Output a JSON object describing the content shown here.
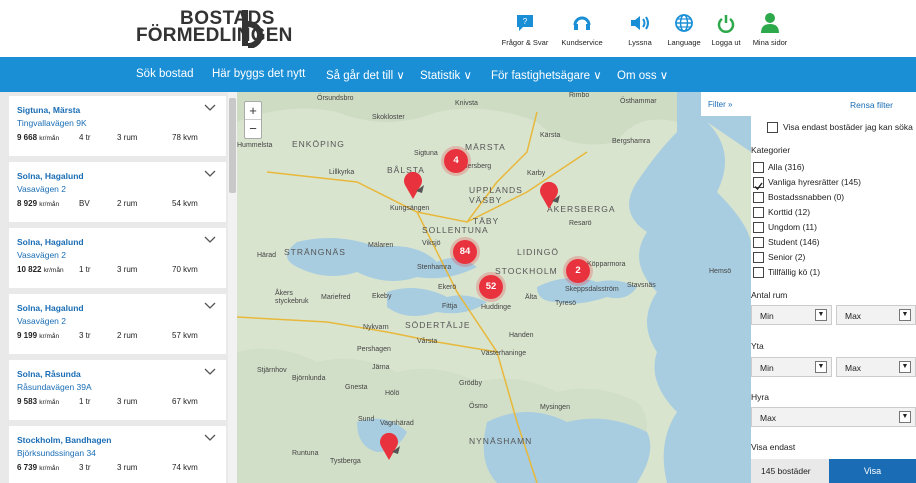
{
  "header": {
    "logo_line1": "BOSTADS",
    "logo_line2": "FÖRMEDLINGEN",
    "utility": [
      {
        "label": "Frågor & Svar",
        "icon": "help-icon"
      },
      {
        "label": "Kundservice",
        "icon": "headset-icon"
      },
      {
        "label": "Lyssna",
        "icon": "speaker-icon"
      },
      {
        "label": "Language",
        "icon": "globe-icon"
      },
      {
        "label": "Logga ut",
        "icon": "power-icon"
      },
      {
        "label": "Mina sidor",
        "icon": "user-icon"
      }
    ]
  },
  "nav": {
    "items": [
      "Sök bostad",
      "Här byggs det nytt",
      "Så går det till ∨",
      "Statistik ∨",
      "För fastighetsägare ∨",
      "Om oss ∨"
    ]
  },
  "listings": [
    {
      "area": "Sigtuna, Märsta",
      "street": "Tingvallavägen 9K",
      "rent": "9 668",
      "unit": "kr/mån",
      "floor": "4 tr",
      "rooms": "3 rum",
      "size": "78 kvm"
    },
    {
      "area": "Solna, Hagalund",
      "street": "Vasavägen 2",
      "rent": "8 929",
      "unit": "kr/mån",
      "floor": "BV",
      "rooms": "2 rum",
      "size": "54 kvm"
    },
    {
      "area": "Solna, Hagalund",
      "street": "Vasavägen 2",
      "rent": "10 822",
      "unit": "kr/mån",
      "floor": "1 tr",
      "rooms": "3 rum",
      "size": "70 kvm"
    },
    {
      "area": "Solna, Hagalund",
      "street": "Vasavägen 2",
      "rent": "9 199",
      "unit": "kr/mån",
      "floor": "3 tr",
      "rooms": "2 rum",
      "size": "57 kvm"
    },
    {
      "area": "Solna, Råsunda",
      "street": "Råsundavägen 39A",
      "rent": "9 583",
      "unit": "kr/mån",
      "floor": "1 tr",
      "rooms": "3 rum",
      "size": "67 kvm"
    },
    {
      "area": "Stockholm, Bandhagen",
      "street": "Björksundssingan 34",
      "rent": "6 739",
      "unit": "kr/mån",
      "floor": "3 tr",
      "rooms": "3 rum",
      "size": "74 kvm"
    }
  ],
  "map": {
    "zoom_in": "+",
    "zoom_out": "−",
    "clusters": [
      "4",
      "84",
      "52",
      "2"
    ],
    "labels": [
      "Örsundsbro",
      "Knivsta",
      "Rimbo",
      "Östhammar",
      "Skokloster",
      "Kärsta",
      "Bergshamra",
      "Hummelsta",
      "ENKÖPING",
      "Sigtuna",
      "MÄRSTA",
      "Lillkyrka",
      "BÅLSTA",
      "Rosersberg",
      "Karby",
      "UPPLANDS VÄSBY",
      "ÅKERSBERGA",
      "Kungsängen",
      "TÄBY",
      "SOLLENTUNA",
      "Resarö",
      "Härad",
      "STRÄNGNÄS",
      "Mälaren",
      "Viksjö",
      "LIDINGÖ",
      "Köpparmora",
      "Stenhamra",
      "STOCKHOLM",
      "Skeppsdalsström",
      "Stavsnäs",
      "Ekerö",
      "Åkers styckebruk",
      "Mariefred",
      "Ekeby",
      "Fittja",
      "Huddinge",
      "Älta",
      "Tyresö",
      "Nykvarn",
      "SÖDERTÄLJE",
      "Handen",
      "Pershagen",
      "Vårsta",
      "Västerhaninge",
      "Stjärnhov",
      "Järna",
      "Björnlunda",
      "Gnesta",
      "Grödby",
      "Hölö",
      "Ösmo",
      "Mysingen",
      "Sund",
      "Vagnhärad",
      "NYNÄSHAMN",
      "Runtuna",
      "Tystberga",
      "Hemsö"
    ]
  },
  "filter": {
    "tab_label": "Filter »",
    "clear_label": "Rensa filter",
    "only_mine": "Visa endast bostäder jag kan söka",
    "categories_title": "Kategorier",
    "categories": [
      {
        "label": "Alla (316)",
        "checked": false
      },
      {
        "label": "Vanliga hyresrätter (145)",
        "checked": true
      },
      {
        "label": "Bostadssnabben (0)",
        "checked": false
      },
      {
        "label": "Korttid (12)",
        "checked": false
      },
      {
        "label": "Ungdom (11)",
        "checked": false
      },
      {
        "label": "Student (146)",
        "checked": false
      },
      {
        "label": "Senior (2)",
        "checked": false
      },
      {
        "label": "Tillfällig kö (1)",
        "checked": false
      }
    ],
    "rooms_title": "Antal rum",
    "rooms_min": "Min",
    "rooms_max": "Max",
    "area_title": "Yta",
    "area_min": "Min",
    "area_max": "Max",
    "rent_title": "Hyra",
    "rent_max": "Max",
    "show_only_title": "Visa endast",
    "count_label": "145 bostäder",
    "show_button": "Visa"
  },
  "colors": {
    "nav_blue": "#1a8fd6",
    "link_blue": "#1a6db5",
    "cluster_red": "#e8323d",
    "icon_blue": "#1a8fd6",
    "icon_green": "#2da84a"
  }
}
